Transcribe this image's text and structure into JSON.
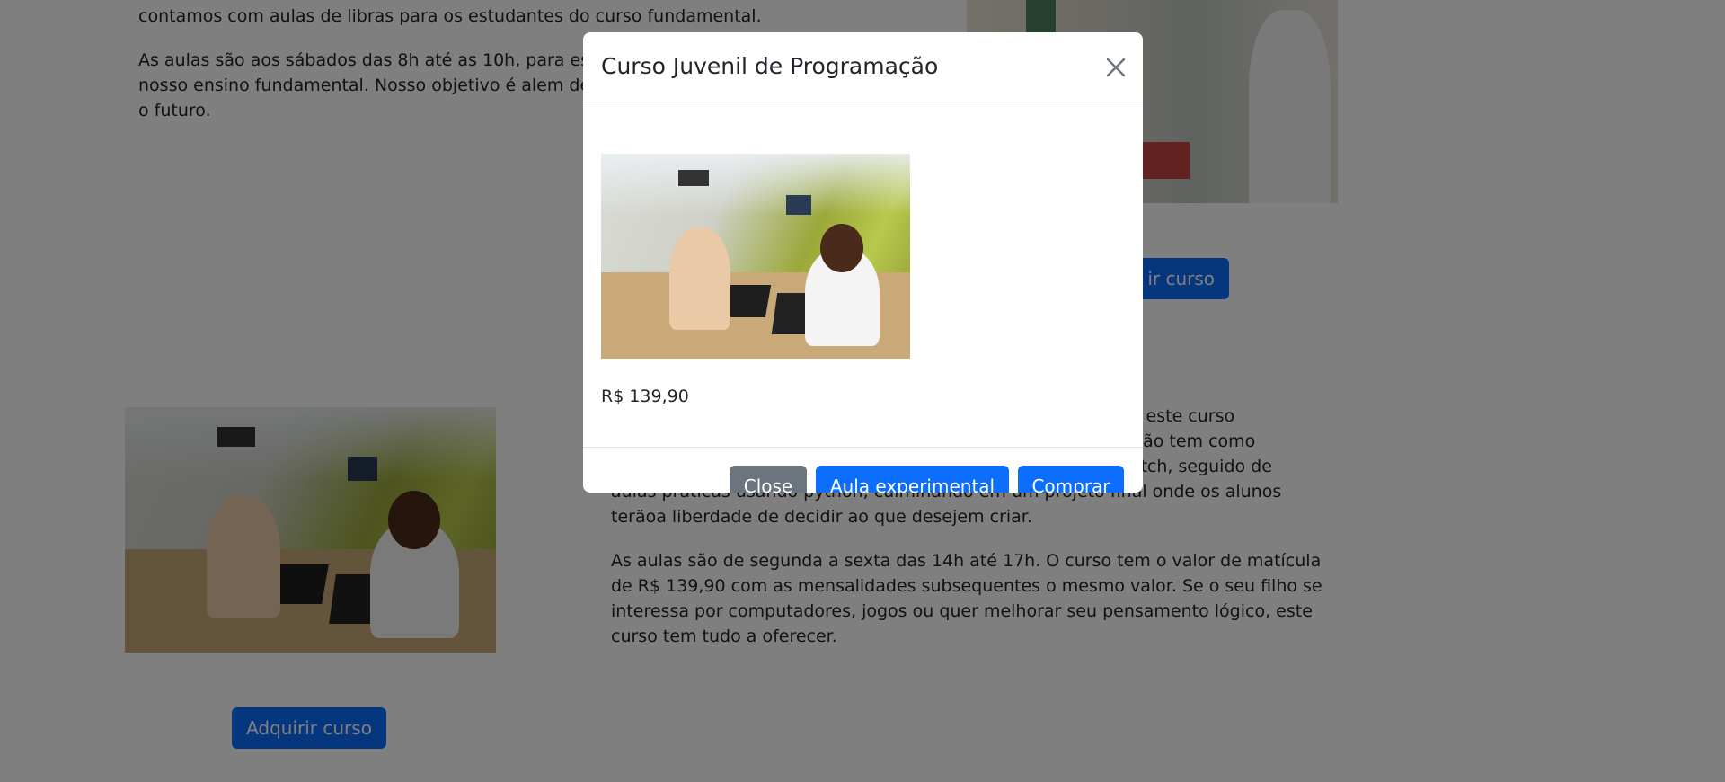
{
  "background": {
    "section1": {
      "para_top": "contamos com aulas de libras para os estudantes do curso fundamental.",
      "para_schedule_lines": [
        "As aulas são aos sábados das 8h até as 10h, para es",
        "nosso ensino fundamental. Nosso objetivo é alem de",
        "o futuro."
      ],
      "buy_button_label": "ir curso"
    },
    "section2": {
      "para_desc_lines": [
        "er este curso",
        "ação tem como",
        "ratch, seguido de",
        "aulas práticas usando python, culminando em um projeto final onde os alunos",
        "teräoa liberdade de decidir ao que desejem criar."
      ],
      "para_price_lines": [
        "As aulas são de segunda a sexta das 14h até 17h. O curso tem o valor de matícula",
        "de R$ 139,90 com as mensalidades subsequentes o mesmo valor. Se o seu filho se",
        "interessa por computadores, jogos ou quer melhorar seu pensamento lógico, este",
        "curso tem tudo a oferecer."
      ],
      "buy_button_label": "Adquirir curso"
    }
  },
  "modal": {
    "title": "Curso Juvenil de Programação",
    "price": "R$ 139,90",
    "buttons": {
      "close_label": "Close",
      "trial_label": "Aula experimental",
      "buy_label": "Comprar"
    }
  },
  "colors": {
    "primary": "#0d6efd",
    "secondary": "#6c757d",
    "backdrop": "rgba(0,0,0,0.5)"
  }
}
